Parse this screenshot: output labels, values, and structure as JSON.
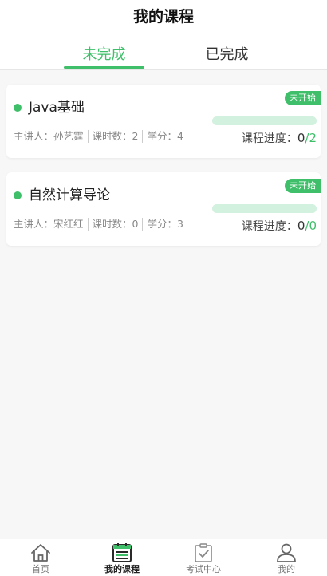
{
  "header": {
    "title": "我的课程",
    "tabs": [
      {
        "label": "未完成",
        "active": true
      },
      {
        "label": "已完成",
        "active": false
      }
    ]
  },
  "courses": [
    {
      "name": "Java基础",
      "badge": "未开始",
      "teacher": "主讲人：孙艺霆",
      "hours": "课时数：2",
      "credits": "学分：4",
      "progress_label": "课程进度：",
      "progress_done": "0",
      "progress_total": "/2",
      "progress_fraction": 0
    },
    {
      "name": "自然计算导论",
      "badge": "未开始",
      "teacher": "主讲人：宋红红",
      "hours": "课时数：0",
      "credits": "学分：3",
      "progress_label": "课程进度：",
      "progress_done": "0",
      "progress_total": "/0",
      "progress_fraction": 0
    }
  ],
  "bottom_nav": [
    {
      "label": "首页",
      "icon": "home-icon"
    },
    {
      "label": "我的课程",
      "icon": "course-list-icon",
      "active": true
    },
    {
      "label": "考试中心",
      "icon": "exam-clipboard-icon"
    },
    {
      "label": "我的",
      "icon": "user-profile-icon"
    }
  ],
  "colors": {
    "accent": "#3fbf6a",
    "progress_track": "#d3f1df"
  }
}
